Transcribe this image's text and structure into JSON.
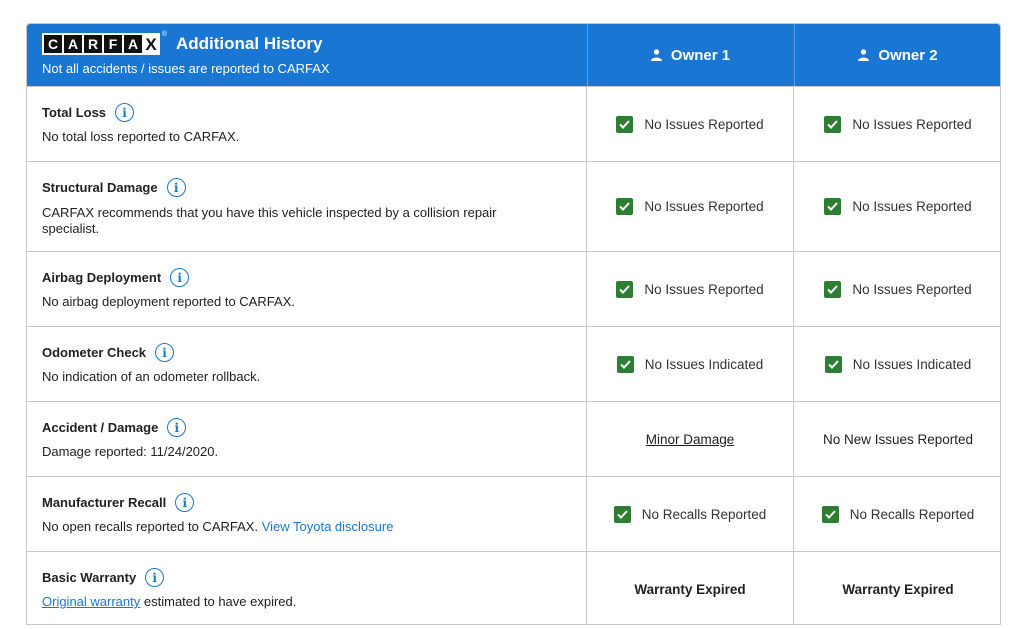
{
  "header": {
    "logo_text": "CARFAX",
    "logo_letters": [
      "C",
      "A",
      "R",
      "F",
      "A",
      "X"
    ],
    "title": "Additional History",
    "subtitle": "Not all accidents / issues are reported to CARFAX",
    "owners": [
      "Owner 1",
      "Owner 2"
    ],
    "background_color": "#1976d2"
  },
  "rows": [
    {
      "title": "Total Loss",
      "desc": "No total loss reported to CARFAX.",
      "owner1": "No Issues Reported",
      "owner2": "No Issues Reported"
    },
    {
      "title": "Structural Damage",
      "desc": "CARFAX recommends that you have this vehicle inspected by a collision repair specialist.",
      "owner1": "No Issues Reported",
      "owner2": "No Issues Reported"
    },
    {
      "title": "Airbag Deployment",
      "desc": "No airbag deployment reported to CARFAX.",
      "owner1": "No Issues Reported",
      "owner2": "No Issues Reported"
    },
    {
      "title": "Odometer Check",
      "desc": "No indication of an odometer rollback.",
      "owner1": "No Issues Indicated",
      "owner2": "No Issues Indicated"
    },
    {
      "title": "Accident / Damage",
      "desc": "Damage reported: 11/24/2020.",
      "owner1": "Minor Damage",
      "owner2": "No New Issues Reported"
    },
    {
      "title": "Manufacturer Recall",
      "desc": "No open recalls reported to CARFAX.",
      "desc_link": "View Toyota disclosure",
      "owner1": "No Recalls Reported",
      "owner2": "No Recalls Reported"
    },
    {
      "title": "Basic Warranty",
      "desc_link": "Original warranty",
      "desc": "estimated to have expired.",
      "owner1": "Warranty Expired",
      "owner2": "Warranty Expired"
    }
  ],
  "colors": {
    "check": "#2e7d32",
    "link": "#1976d2"
  }
}
